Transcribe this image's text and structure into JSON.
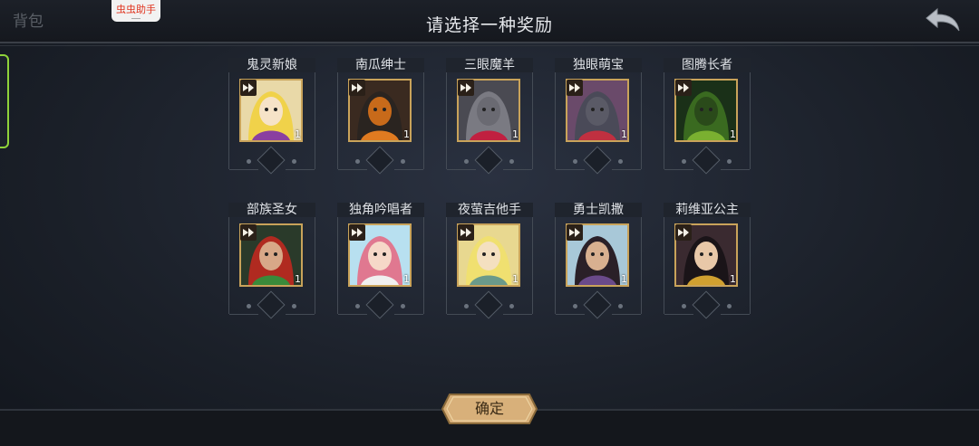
{
  "header": {
    "back_text": "背包",
    "helper_badge": "虫虫助手",
    "title": "请选择一种奖励"
  },
  "rewards": [
    {
      "name": "鬼灵新娘",
      "count": "1",
      "palette": {
        "bg": "#e9d9a8",
        "hair": "#f0d24a",
        "accent": "#8a3fa0",
        "face": "#f6e3c8"
      }
    },
    {
      "name": "南瓜绅士",
      "count": "1",
      "palette": {
        "bg": "#3a2a20",
        "hair": "#2a2420",
        "accent": "#e07a20",
        "face": "#c86a1a"
      }
    },
    {
      "name": "三眼魔羊",
      "count": "1",
      "palette": {
        "bg": "#4a4a52",
        "hair": "#7a7a82",
        "accent": "#c02040",
        "face": "#6a6a72"
      }
    },
    {
      "name": "独眼萌宝",
      "count": "1",
      "palette": {
        "bg": "#6a4a6a",
        "hair": "#4a4a58",
        "accent": "#c03040",
        "face": "#5a5a66"
      }
    },
    {
      "name": "图腾长者",
      "count": "1",
      "palette": {
        "bg": "#1a3018",
        "hair": "#3a6a20",
        "accent": "#7ab030",
        "face": "#2a4a1a"
      }
    },
    {
      "name": "部族圣女",
      "count": "1",
      "palette": {
        "bg": "#2a3a2a",
        "hair": "#b02a20",
        "accent": "#3a8a3a",
        "face": "#d8a888"
      }
    },
    {
      "name": "独角吟唱者",
      "count": "1",
      "palette": {
        "bg": "#b8e0f0",
        "hair": "#e07890",
        "accent": "#f0f0f0",
        "face": "#f6d8c8"
      }
    },
    {
      "name": "夜萤吉他手",
      "count": "1",
      "palette": {
        "bg": "#e8d890",
        "hair": "#f0e070",
        "accent": "#6a9a8a",
        "face": "#f4e0c0"
      }
    },
    {
      "name": "勇士凯撒",
      "count": "1",
      "palette": {
        "bg": "#a8c8d8",
        "hair": "#2a2028",
        "accent": "#6a4a8a",
        "face": "#d8b090"
      }
    },
    {
      "name": "莉维亚公主",
      "count": "1",
      "palette": {
        "bg": "#3a2a30",
        "hair": "#1a1418",
        "accent": "#d0a030",
        "face": "#e8c8a8"
      }
    }
  ],
  "confirm_label": "确定",
  "colors": {
    "frame_gold": "#c9a35a",
    "side_tab_green": "#8fd33a",
    "helper_red": "#e0341f"
  }
}
